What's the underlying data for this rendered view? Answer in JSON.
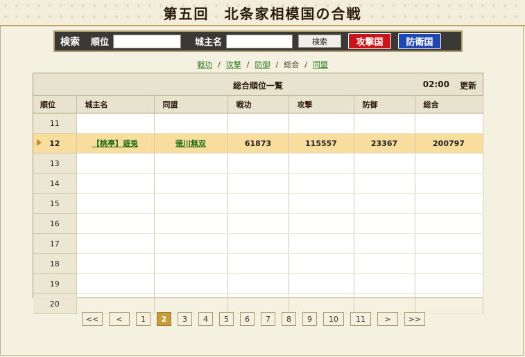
{
  "title": "第五回　北条家相模国の合戦",
  "search": {
    "label": "検索",
    "rank_label": "順位",
    "rank_value": "",
    "owner_label": "城主名",
    "owner_value": "",
    "search_button": "検索",
    "attack_button": "攻撃国",
    "defend_button": "防衛国"
  },
  "tabs": [
    {
      "label": "戦功",
      "link": true
    },
    {
      "label": "攻撃",
      "link": true
    },
    {
      "label": "防御",
      "link": true
    },
    {
      "label": "総合",
      "link": false
    },
    {
      "label": "同盟",
      "link": true
    }
  ],
  "tab_separator": "/",
  "ranking": {
    "caption": "総合順位一覧",
    "time": "02:00",
    "update_label": "更新",
    "columns": [
      "順位",
      "城主名",
      "同盟",
      "戦功",
      "攻撃",
      "防御",
      "総合"
    ],
    "rows": [
      {
        "rank": "11",
        "owner": "",
        "alliance": "",
        "merit": "",
        "attack": "",
        "defense": "",
        "total": ""
      },
      {
        "rank": "12",
        "owner": "【桃亭】遊兎",
        "alliance": "徳川無双",
        "merit": "61873",
        "attack": "115557",
        "defense": "23367",
        "total": "200797",
        "highlight": true
      },
      {
        "rank": "13"
      },
      {
        "rank": "14"
      },
      {
        "rank": "15"
      },
      {
        "rank": "16"
      },
      {
        "rank": "17"
      },
      {
        "rank": "18"
      },
      {
        "rank": "19"
      },
      {
        "rank": "20"
      }
    ]
  },
  "pager": {
    "first": "<<",
    "prev": "<",
    "pages": [
      "1",
      "2",
      "3",
      "4",
      "5",
      "6",
      "7",
      "8",
      "9",
      "10",
      "11"
    ],
    "current": "2",
    "next": ">",
    "last": ">>"
  },
  "colors": {
    "highlight_row": "#f9dd9e",
    "attack_button": "#c8141b",
    "defend_button": "#2046b0",
    "link": "#2b7a1f",
    "current_page": "#c59d3a"
  }
}
